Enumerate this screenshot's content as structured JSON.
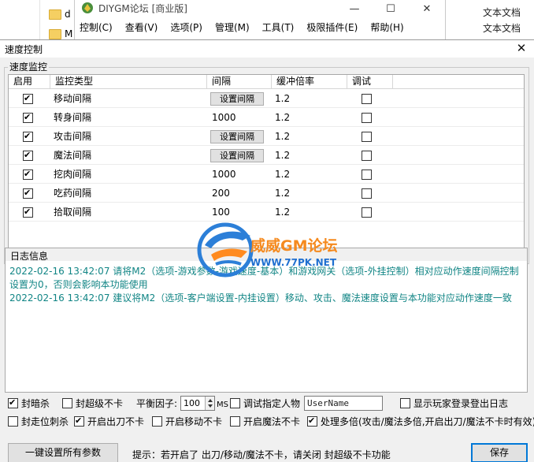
{
  "background": {
    "folder_label_1": "d",
    "folder_label_2": "M",
    "file_type_1": "文本文档",
    "file_type_2": "文本文档",
    "app_title": "DIYGM论坛 [商业版]",
    "app_menu": [
      "控制(C)",
      "查看(V)",
      "选项(P)",
      "管理(M)",
      "工具(T)",
      "极限插件(E)",
      "帮助(H)"
    ]
  },
  "dialog": {
    "title": "速度控制",
    "speed_group_label": "速度监控",
    "columns": [
      "启用",
      "监控类型",
      "间隔",
      "缓冲倍率",
      "调试"
    ],
    "rows": [
      {
        "enabled": true,
        "type": "移动间隔",
        "interval": "设置间隔",
        "is_button": true,
        "rate": "1.2",
        "debug": false
      },
      {
        "enabled": true,
        "type": "转身间隔",
        "interval": "1000",
        "is_button": false,
        "rate": "1.2",
        "debug": false
      },
      {
        "enabled": true,
        "type": "攻击间隔",
        "interval": "设置间隔",
        "is_button": true,
        "rate": "1.2",
        "debug": false
      },
      {
        "enabled": true,
        "type": "魔法间隔",
        "interval": "设置间隔",
        "is_button": true,
        "rate": "1.2",
        "debug": false
      },
      {
        "enabled": true,
        "type": "挖肉间隔",
        "interval": "1000",
        "is_button": false,
        "rate": "1.2",
        "debug": false
      },
      {
        "enabled": true,
        "type": "吃药间隔",
        "interval": "200",
        "is_button": false,
        "rate": "1.2",
        "debug": false
      },
      {
        "enabled": true,
        "type": "拾取间隔",
        "interval": "100",
        "is_button": false,
        "rate": "1.2",
        "debug": false
      }
    ],
    "log_label": "日志信息",
    "log_lines": [
      "2022-02-16 13:42:07 请将M2（选项-游戏参数-游戏速度-基本）和游戏网关（选项-外挂控制）相对应动作速度间隔控制设置为0，否则会影响本功能使用",
      "2022-02-16 13:42:07 建议将M2（选项-客户端设置-内挂设置）移动、攻击、魔法速度设置与本功能对应动作速度一致"
    ],
    "watermark_title": "威威GM论坛",
    "watermark_url": "WWW.77PK.NET",
    "options": {
      "anti_stealth": "封暗杀",
      "super_no_lag": "封超级不卡",
      "balance_label": "平衡因子:",
      "balance_value": "100",
      "balance_unit": "MS",
      "debug_player": "调试指定人物",
      "username_value": "UserName",
      "show_login_log": "显示玩家登录登出日志",
      "anti_walk_kill": "封走位刺杀",
      "open_sword_no_lag": "开启出刀不卡",
      "open_move_no_lag": "开启移动不卡",
      "open_magic_no_lag": "开启魔法不卡",
      "multi_process": "处理多倍(攻击/魔法多倍,开启出刀/魔法不卡时有效)"
    },
    "set_all_button": "一键设置所有参数",
    "hint": "提示：若开启了 出刀/移动/魔法不卡，请关闭 封超级不卡功能",
    "save_button": "保存"
  }
}
